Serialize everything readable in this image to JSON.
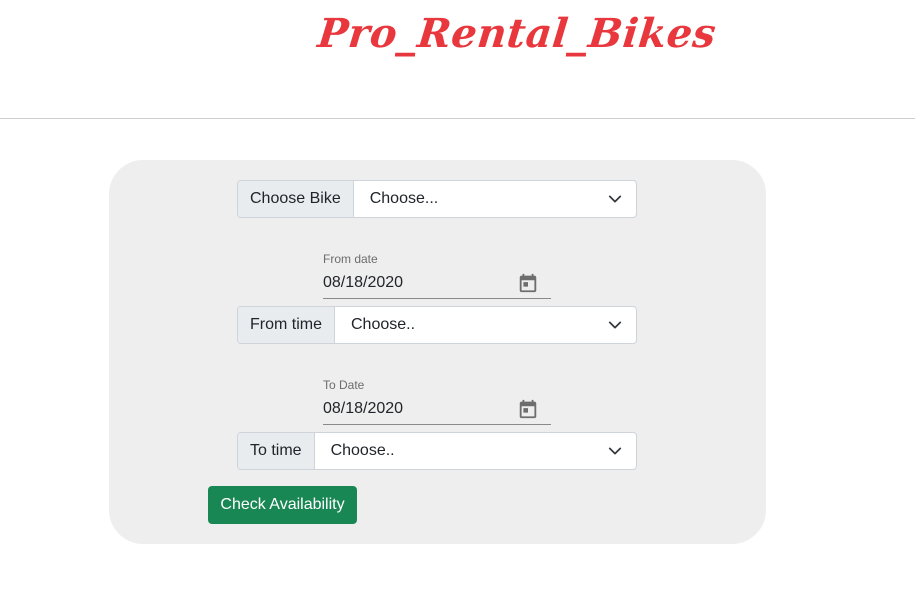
{
  "header": {
    "brand": "Pro_Rental_Bikes"
  },
  "form": {
    "bike": {
      "label": "Choose Bike",
      "value": "Choose..."
    },
    "from_date": {
      "label": "From date",
      "value": "08/18/2020"
    },
    "from_time": {
      "label": "From time",
      "value": "Choose.."
    },
    "to_date": {
      "label": "To Date",
      "value": "08/18/2020"
    },
    "to_time": {
      "label": "To time",
      "value": "Choose.."
    },
    "submit_label": "Check Availability"
  },
  "colors": {
    "brand": "#e8373d",
    "panel": "#efeeef",
    "button": "#198754"
  },
  "icons": {
    "select": "chevron-down-icon",
    "date": "calendar-icon"
  }
}
